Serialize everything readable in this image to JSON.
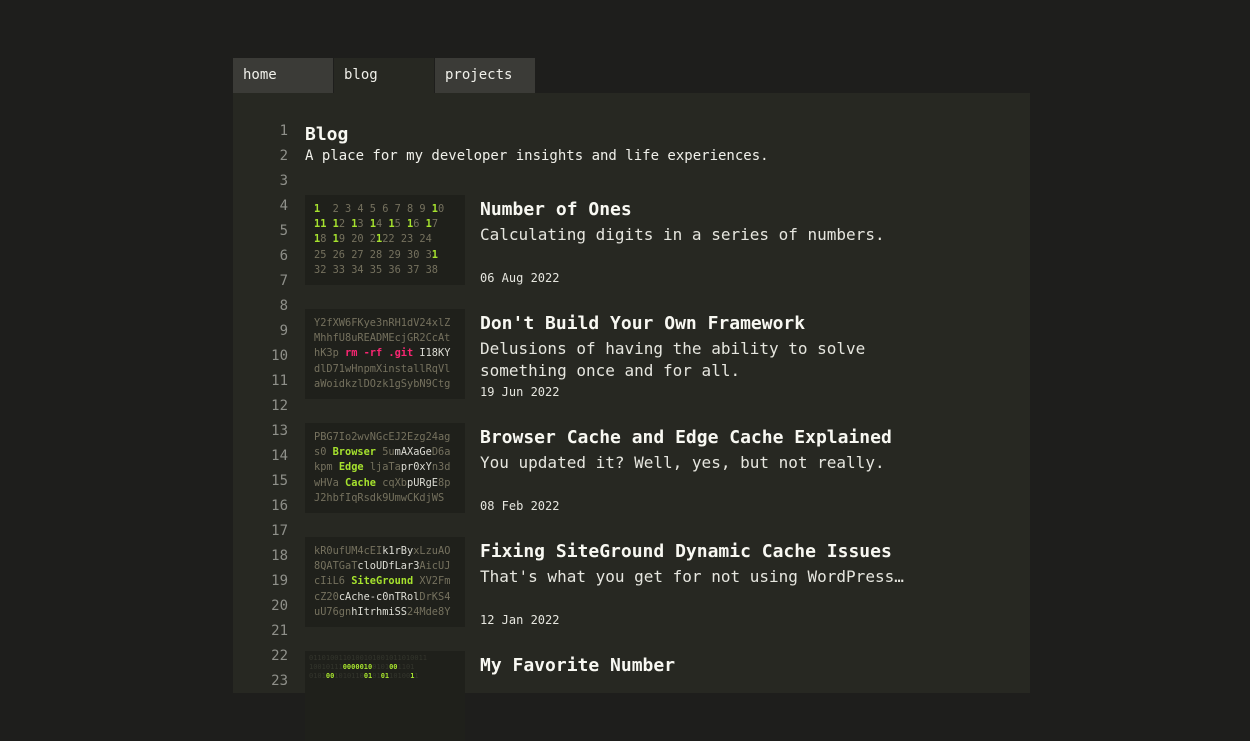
{
  "tabs": [
    {
      "label": "home"
    },
    {
      "label": "blog"
    },
    {
      "label": "projects"
    }
  ],
  "line_numbers": [
    "1",
    "2",
    "3",
    "4",
    "5",
    "6",
    "7",
    "8",
    "9",
    "10",
    "11",
    "12",
    "13",
    "14",
    "15",
    "16",
    "17",
    "18",
    "19",
    "20",
    "21",
    "22",
    "23"
  ],
  "blog": {
    "title": "Blog",
    "subtitle": "A place for my developer insights and life experiences."
  },
  "posts": [
    {
      "title": "Number of Ones",
      "description": "Calculating digits in a series of numbers.",
      "date": "06 Aug 2022",
      "thumbnail": [
        [
          [
            "g",
            "1"
          ],
          [
            "",
            "  2 3 4 5 6 7 8 9 "
          ],
          [
            "g",
            "1"
          ],
          [
            "",
            "0"
          ]
        ],
        [
          [
            "g",
            "11"
          ],
          [
            "",
            ""
          ],
          [
            "g",
            " 1"
          ],
          [
            "",
            "2 "
          ],
          [
            "g",
            "1"
          ],
          [
            "",
            "3 "
          ],
          [
            "g",
            "1"
          ],
          [
            "",
            "4 "
          ],
          [
            "g",
            "1"
          ],
          [
            "",
            "5 "
          ],
          [
            "g",
            "1"
          ],
          [
            "",
            "6 "
          ],
          [
            "g",
            "1"
          ],
          [
            "",
            "7"
          ]
        ],
        [
          [
            "g",
            "1"
          ],
          [
            "",
            "8 "
          ],
          [
            "g",
            "1"
          ],
          [
            "",
            "9 20 2"
          ],
          [
            "g",
            "1"
          ],
          [
            "",
            "22 23 24"
          ]
        ],
        [
          [
            "",
            "25 26 27 28 29 30 3"
          ],
          [
            "g",
            "1"
          ]
        ],
        [
          [
            "",
            "32 33 34 35 36 37 38"
          ]
        ]
      ]
    },
    {
      "title": "Don't Build Your Own Framework",
      "description": "Delusions of having the ability to solve something once and for all.",
      "date": "19 Jun 2022",
      "thumbnail": [
        [
          [
            "",
            "Y2fXW6FKye3nRH1dV24xlZ"
          ]
        ],
        [
          [
            "",
            "MhhfU8uREADMEcjGR2CcAt"
          ]
        ],
        [
          [
            "",
            "hK3p "
          ],
          [
            "p",
            "rm -rf .git"
          ],
          [
            "w",
            " I18KY"
          ]
        ],
        [
          [
            "",
            "dlD71wHnpmXinstallRqVl"
          ]
        ],
        [
          [
            "",
            "aWoidkzlDOzk1gSybN9Ctg"
          ]
        ]
      ]
    },
    {
      "title": "Browser Cache and Edge Cache Explained",
      "description": "You updated it? Well, yes, but not really.",
      "date": "08 Feb 2022",
      "thumbnail": [
        [
          [
            "",
            "PBG7Io2wvNGcEJ2Ezg24ag"
          ]
        ],
        [
          [
            "",
            "s0 "
          ],
          [
            "g",
            "Browser"
          ],
          [
            "",
            " 5u"
          ],
          [
            "w",
            "mAXaGe"
          ],
          [
            "",
            "D6a"
          ]
        ],
        [
          [
            "",
            "kpm "
          ],
          [
            "g",
            "Edge"
          ],
          [
            "",
            " ljaTa"
          ],
          [
            "w",
            "pr0xY"
          ],
          [
            "",
            "n3d"
          ]
        ],
        [
          [
            "",
            "wHVa "
          ],
          [
            "g",
            "Cache"
          ],
          [
            "",
            " cqXb"
          ],
          [
            "w",
            "pURgE"
          ],
          [
            "",
            "8p"
          ]
        ],
        [
          [
            "",
            "J2hbfIqRsdk9UmwCKdjWS"
          ]
        ]
      ]
    },
    {
      "title": "Fixing SiteGround Dynamic Cache Issues",
      "description": "That's what you get for not using WordPress…",
      "date": "12 Jan 2022",
      "thumbnail": [
        [
          [
            "",
            "kR0ufUM4cEI"
          ],
          [
            "w",
            "k1rBy"
          ],
          [
            "",
            "xLzuAO"
          ]
        ],
        [
          [
            "",
            "8QATGaT"
          ],
          [
            "w",
            "cloUDfLar3"
          ],
          [
            "",
            "AicUJ"
          ]
        ],
        [
          [
            "",
            "cIiL6 "
          ],
          [
            "g",
            "SiteGround"
          ],
          [
            "",
            " XV2Fm"
          ]
        ],
        [
          [
            "",
            "cZ20"
          ],
          [
            "w",
            "cAche-c0nTRol"
          ],
          [
            "",
            "DrKS4"
          ]
        ],
        [
          [
            "",
            "uU76gn"
          ],
          [
            "w",
            "hItrhmiSS"
          ],
          [
            "",
            "24Mde8Y"
          ]
        ]
      ]
    },
    {
      "title": "My Favorite Number",
      "description": "",
      "date": "",
      "thumbnail": [
        [
          [
            "",
            "0110100110100101001011010011"
          ]
        ],
        [
          [
            "",
            "10010111"
          ],
          [
            "g",
            "0000010"
          ],
          [
            "",
            "0101"
          ],
          [
            "g",
            "00"
          ],
          [
            "",
            "1101"
          ]
        ],
        [
          [
            "",
            "0101"
          ],
          [
            "g",
            "00"
          ],
          [
            "",
            "1010110"
          ],
          [
            "g",
            "01"
          ],
          [
            "",
            "01"
          ],
          [
            "g",
            "01"
          ],
          [
            "",
            "10100"
          ],
          [
            "g",
            "1"
          ],
          [
            "",
            "1"
          ]
        ]
      ]
    }
  ]
}
